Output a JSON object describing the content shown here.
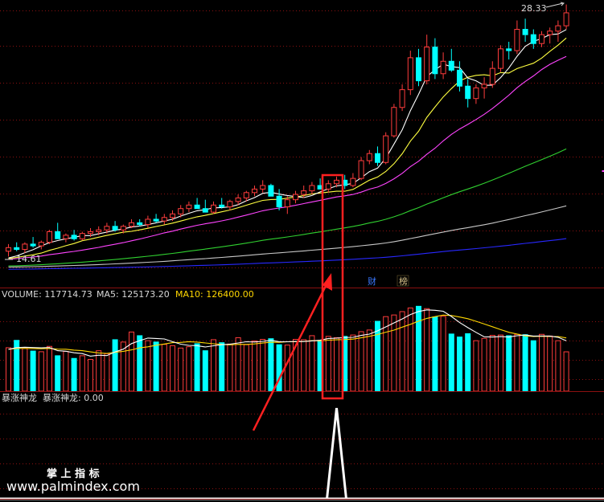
{
  "price_panel": {
    "high_label": "28.33",
    "low_label": "14.61",
    "badges": [
      {
        "text": "财",
        "color": "#3a78ff"
      },
      {
        "text": "榜",
        "color": "#d9c48a"
      }
    ]
  },
  "volume_panel": {
    "readout": [
      {
        "text": "VOLUME: 117714.73",
        "color": "#d8d8d8"
      },
      {
        "text": "MA5: 125173.20",
        "color": "#d8d8d8"
      },
      {
        "text": "MA10: 126400.00",
        "color": "#ffd700"
      }
    ]
  },
  "indicator_panel": {
    "readout": [
      {
        "text": "暴涨神龙",
        "color": "#d8d8d8"
      },
      {
        "text": "暴涨神龙: 0.00",
        "color": "#d8d8d8"
      }
    ]
  },
  "watermark": {
    "title": "掌 上 指 标",
    "url": "www.palmindex.com"
  },
  "colors": {
    "up": "#ff3c3c",
    "down": "#00ffff",
    "ma5": "#ffffff",
    "ma10": "#ffff40",
    "ma20": "#ff44ff",
    "ma60": "#30d030",
    "ma120": "#c8c8c8",
    "ma250": "#2828ff",
    "grid": "#8b1010",
    "annotation": "#ff2020"
  },
  "chart_data": {
    "type": "candlestick",
    "ohlc": [
      [
        14.9,
        15.3,
        14.6,
        15.1
      ],
      [
        15.1,
        15.4,
        14.9,
        15.0
      ],
      [
        15.0,
        15.4,
        14.8,
        15.3
      ],
      [
        15.3,
        15.7,
        15.1,
        15.2
      ],
      [
        15.2,
        15.5,
        15.0,
        15.4
      ],
      [
        15.4,
        16.1,
        15.3,
        16.0
      ],
      [
        16.0,
        16.5,
        15.9,
        15.6
      ],
      [
        15.6,
        15.9,
        15.4,
        15.8
      ],
      [
        15.8,
        16.1,
        15.5,
        15.6
      ],
      [
        15.6,
        16.0,
        15.5,
        15.9
      ],
      [
        15.9,
        16.2,
        15.7,
        16.0
      ],
      [
        16.0,
        16.3,
        15.8,
        16.1
      ],
      [
        16.1,
        16.5,
        15.9,
        16.3
      ],
      [
        16.3,
        16.6,
        16.0,
        16.1
      ],
      [
        16.1,
        16.4,
        15.9,
        16.3
      ],
      [
        16.3,
        16.7,
        16.2,
        16.5
      ],
      [
        16.5,
        16.7,
        16.3,
        16.4
      ],
      [
        16.4,
        16.9,
        16.2,
        16.7
      ],
      [
        16.7,
        17.0,
        16.5,
        16.6
      ],
      [
        16.6,
        17.0,
        16.4,
        16.8
      ],
      [
        16.8,
        17.2,
        16.6,
        17.0
      ],
      [
        17.0,
        17.5,
        16.8,
        17.3
      ],
      [
        17.3,
        17.7,
        17.1,
        17.5
      ],
      [
        17.5,
        17.9,
        17.3,
        17.3
      ],
      [
        17.3,
        17.8,
        17.2,
        17.1
      ],
      [
        17.1,
        17.7,
        17.0,
        17.5
      ],
      [
        17.5,
        17.9,
        17.3,
        17.4
      ],
      [
        17.4,
        17.8,
        17.2,
        17.7
      ],
      [
        17.7,
        18.1,
        17.5,
        17.9
      ],
      [
        17.9,
        18.3,
        17.7,
        18.2
      ],
      [
        18.2,
        18.6,
        18.0,
        18.4
      ],
      [
        18.4,
        18.9,
        18.2,
        18.6
      ],
      [
        18.6,
        18.7,
        18.0,
        18.0
      ],
      [
        18.0,
        18.4,
        17.2,
        17.4
      ],
      [
        17.4,
        18.0,
        17.0,
        17.8
      ],
      [
        17.8,
        18.3,
        17.6,
        18.1
      ],
      [
        18.1,
        18.6,
        17.9,
        18.3
      ],
      [
        18.3,
        18.8,
        18.1,
        18.6
      ],
      [
        18.6,
        19.0,
        18.4,
        18.4
      ],
      [
        18.4,
        18.9,
        18.2,
        18.7
      ],
      [
        18.7,
        19.1,
        18.5,
        18.9
      ],
      [
        18.9,
        19.2,
        18.4,
        18.6
      ],
      [
        18.6,
        19.3,
        18.5,
        19.0
      ],
      [
        19.0,
        20.2,
        18.9,
        20.0
      ],
      [
        20.0,
        20.6,
        19.8,
        20.4
      ],
      [
        20.4,
        20.8,
        19.7,
        19.9
      ],
      [
        19.9,
        21.6,
        19.8,
        21.4
      ],
      [
        21.4,
        23.2,
        21.3,
        23.0
      ],
      [
        23.0,
        24.3,
        22.8,
        24.0
      ],
      [
        24.0,
        26.2,
        23.7,
        25.8
      ],
      [
        25.8,
        26.3,
        24.2,
        24.5
      ],
      [
        24.5,
        27.1,
        24.3,
        26.4
      ],
      [
        26.4,
        26.9,
        24.6,
        24.9
      ],
      [
        24.9,
        26.1,
        24.6,
        25.6
      ],
      [
        25.6,
        26.3,
        25.0,
        25.1
      ],
      [
        25.1,
        25.6,
        23.9,
        24.2
      ],
      [
        24.2,
        24.6,
        23.0,
        23.5
      ],
      [
        23.5,
        24.3,
        23.2,
        24.1
      ],
      [
        24.1,
        24.7,
        23.5,
        24.3
      ],
      [
        24.3,
        25.6,
        24.1,
        25.2
      ],
      [
        25.2,
        26.5,
        25.0,
        26.3
      ],
      [
        26.3,
        26.7,
        25.7,
        26.2
      ],
      [
        26.2,
        27.9,
        26.0,
        27.4
      ],
      [
        27.4,
        28.0,
        26.7,
        27.1
      ],
      [
        27.1,
        27.4,
        26.3,
        26.6
      ],
      [
        26.6,
        27.3,
        26.4,
        27.1
      ],
      [
        27.1,
        27.5,
        26.6,
        27.3
      ],
      [
        27.3,
        27.9,
        26.7,
        27.6
      ],
      [
        27.6,
        28.8,
        27.4,
        28.33
      ]
    ],
    "volume": [
      130000,
      152000,
      128000,
      120000,
      118000,
      134000,
      106000,
      119000,
      98000,
      106000,
      95000,
      121000,
      112000,
      154000,
      147000,
      177000,
      166000,
      151000,
      147000,
      140000,
      136000,
      129000,
      133000,
      142000,
      121000,
      154000,
      145000,
      141000,
      160000,
      139000,
      150000,
      155000,
      157000,
      139000,
      138000,
      155000,
      154000,
      166000,
      149000,
      164000,
      160000,
      164000,
      168000,
      178000,
      183000,
      209000,
      223000,
      228000,
      238000,
      249000,
      254000,
      247000,
      222000,
      224000,
      171000,
      162000,
      172000,
      151000,
      158000,
      167000,
      168000,
      166000,
      170000,
      169000,
      151000,
      170000,
      165000,
      151000,
      117714.73
    ],
    "ma_series": [
      "MA5",
      "MA10",
      "MA20",
      "MA60",
      "MA120",
      "MA250"
    ],
    "volume_ma": [
      "MA5",
      "MA10"
    ],
    "y_range": [
      14.61,
      28.33
    ]
  }
}
